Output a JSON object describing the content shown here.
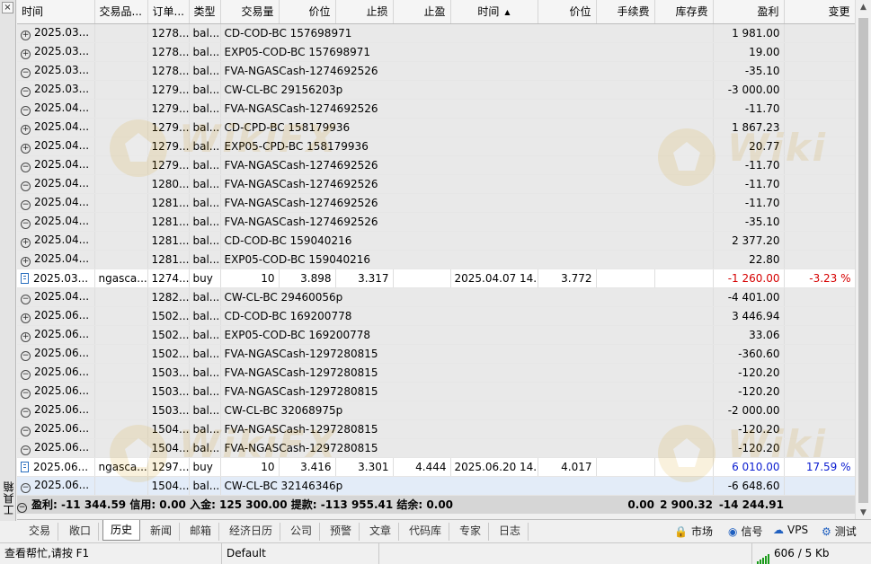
{
  "columns": [
    "时间",
    "交易品...",
    "订单...",
    "类型",
    "交易量",
    "价位",
    "止损",
    "止盈",
    "时间",
    "价位",
    "手续费",
    "库存费",
    "盈利",
    "变更"
  ],
  "rows": [
    {
      "kind": "bal",
      "icon": "plus",
      "time": "2025.03...",
      "order": "1278...",
      "type": "bal...",
      "comment": "CD-COD-BC 157698971",
      "profit": "1 981.00",
      "sign": "none"
    },
    {
      "kind": "bal",
      "icon": "plus",
      "time": "2025.03...",
      "order": "1278...",
      "type": "bal...",
      "comment": "EXP05-COD-BC 157698971",
      "profit": "19.00",
      "sign": "none"
    },
    {
      "kind": "bal",
      "icon": "minus",
      "time": "2025.03...",
      "order": "1278...",
      "type": "bal...",
      "comment": "FVA-NGASCash-1274692526",
      "profit": "-35.10",
      "sign": "none"
    },
    {
      "kind": "bal",
      "icon": "minus",
      "time": "2025.03...",
      "order": "1279...",
      "type": "bal...",
      "comment": "CW-CL-BC 29156203p",
      "profit": "-3 000.00",
      "sign": "none"
    },
    {
      "kind": "bal",
      "icon": "minus",
      "time": "2025.04...",
      "order": "1279...",
      "type": "bal...",
      "comment": "FVA-NGASCash-1274692526",
      "profit": "-11.70",
      "sign": "none"
    },
    {
      "kind": "bal",
      "icon": "plus",
      "time": "2025.04...",
      "order": "1279...",
      "type": "bal...",
      "comment": "CD-CPD-BC 158179936",
      "profit": "1 867.23",
      "sign": "none"
    },
    {
      "kind": "bal",
      "icon": "plus",
      "time": "2025.04...",
      "order": "1279...",
      "type": "bal...",
      "comment": "EXP05-CPD-BC 158179936",
      "profit": "20.77",
      "sign": "none"
    },
    {
      "kind": "bal",
      "icon": "minus",
      "time": "2025.04...",
      "order": "1279...",
      "type": "bal...",
      "comment": "FVA-NGASCash-1274692526",
      "profit": "-11.70",
      "sign": "none"
    },
    {
      "kind": "bal",
      "icon": "minus",
      "time": "2025.04...",
      "order": "1280...",
      "type": "bal...",
      "comment": "FVA-NGASCash-1274692526",
      "profit": "-11.70",
      "sign": "none"
    },
    {
      "kind": "bal",
      "icon": "minus",
      "time": "2025.04...",
      "order": "1281...",
      "type": "bal...",
      "comment": "FVA-NGASCash-1274692526",
      "profit": "-11.70",
      "sign": "none"
    },
    {
      "kind": "bal",
      "icon": "minus",
      "time": "2025.04...",
      "order": "1281...",
      "type": "bal...",
      "comment": "FVA-NGASCash-1274692526",
      "profit": "-35.10",
      "sign": "none"
    },
    {
      "kind": "bal",
      "icon": "plus",
      "time": "2025.04...",
      "order": "1281...",
      "type": "bal...",
      "comment": "CD-COD-BC 159040216",
      "profit": "2 377.20",
      "sign": "none"
    },
    {
      "kind": "bal",
      "icon": "plus",
      "time": "2025.04...",
      "order": "1281...",
      "type": "bal...",
      "comment": "EXP05-COD-BC 159040216",
      "profit": "22.80",
      "sign": "none"
    },
    {
      "kind": "trade",
      "icon": "trade",
      "time": "2025.03...",
      "symbol": "ngasca...",
      "order": "1274...",
      "type": "buy",
      "volume": "10",
      "price": "3.898",
      "sl": "3.317",
      "tp": "",
      "close_time": "2025.04.07 14...",
      "close_price": "3.772",
      "commission": "",
      "swap": "",
      "profit": "-1 260.00",
      "change": "-3.23 %",
      "sign": "neg"
    },
    {
      "kind": "bal",
      "icon": "minus",
      "time": "2025.04...",
      "order": "1282...",
      "type": "bal...",
      "comment": "CW-CL-BC 29460056p",
      "profit": "-4 401.00",
      "sign": "none"
    },
    {
      "kind": "bal",
      "icon": "plus",
      "time": "2025.06...",
      "order": "1502...",
      "type": "bal...",
      "comment": "CD-COD-BC 169200778",
      "profit": "3 446.94",
      "sign": "none"
    },
    {
      "kind": "bal",
      "icon": "plus",
      "time": "2025.06...",
      "order": "1502...",
      "type": "bal...",
      "comment": "EXP05-COD-BC 169200778",
      "profit": "33.06",
      "sign": "none"
    },
    {
      "kind": "bal",
      "icon": "minus",
      "time": "2025.06...",
      "order": "1502...",
      "type": "bal...",
      "comment": "FVA-NGASCash-1297280815",
      "profit": "-360.60",
      "sign": "none"
    },
    {
      "kind": "bal",
      "icon": "minus",
      "time": "2025.06...",
      "order": "1503...",
      "type": "bal...",
      "comment": "FVA-NGASCash-1297280815",
      "profit": "-120.20",
      "sign": "none"
    },
    {
      "kind": "bal",
      "icon": "minus",
      "time": "2025.06...",
      "order": "1503...",
      "type": "bal...",
      "comment": "FVA-NGASCash-1297280815",
      "profit": "-120.20",
      "sign": "none"
    },
    {
      "kind": "bal",
      "icon": "minus",
      "time": "2025.06...",
      "order": "1503...",
      "type": "bal...",
      "comment": "CW-CL-BC 32068975p",
      "profit": "-2 000.00",
      "sign": "none"
    },
    {
      "kind": "bal",
      "icon": "minus",
      "time": "2025.06...",
      "order": "1504...",
      "type": "bal...",
      "comment": "FVA-NGASCash-1297280815",
      "profit": "-120.20",
      "sign": "none"
    },
    {
      "kind": "bal",
      "icon": "minus",
      "time": "2025.06...",
      "order": "1504...",
      "type": "bal...",
      "comment": "FVA-NGASCash-1297280815",
      "profit": "-120.20",
      "sign": "none"
    },
    {
      "kind": "trade",
      "icon": "trade",
      "time": "2025.06...",
      "symbol": "ngasca...",
      "order": "1297...",
      "type": "buy",
      "volume": "10",
      "price": "3.416",
      "sl": "3.301",
      "tp": "4.444",
      "close_time": "2025.06.20 14...",
      "close_price": "4.017",
      "commission": "",
      "swap": "",
      "profit": "6 010.00",
      "change": "17.59 %",
      "sign": "pos"
    },
    {
      "kind": "bal",
      "icon": "minus",
      "time": "2025.06...",
      "order": "1504...",
      "type": "bal...",
      "comment": "CW-CL-BC 32146346p",
      "profit": "-6 648.60",
      "sign": "none",
      "selected": true
    }
  ],
  "summary": {
    "text": "盈利: -11 344.59  信用: 0.00  入金: 125 300.00  提款: -113 955.41  结余: 0.00",
    "commission": "0.00",
    "swap": "2 900.32",
    "profit": "-14 244.91"
  },
  "toolbox_label": "工具箱",
  "tabs": [
    "交易",
    "敞口",
    "历史",
    "新闻",
    "邮箱",
    "经济日历",
    "公司",
    "预警",
    "文章",
    "代码库",
    "专家",
    "日志"
  ],
  "active_tab": "历史",
  "right_tabs": [
    {
      "icon": "market-icon",
      "label": "市场"
    },
    {
      "icon": "signal-icon",
      "label": "信号"
    },
    {
      "icon": "vps-icon",
      "label": "VPS"
    },
    {
      "icon": "tester-icon",
      "label": "测试"
    }
  ],
  "status": {
    "help": "查看帮忙,请按 F1",
    "profile": "Default",
    "traffic": "606 / 5 Kb"
  },
  "colors": {
    "negative": "#d60000",
    "positive": "#0a1cd0",
    "balance_row": "#e9e9e9",
    "selected_row": "#e3ecf8",
    "summary_row": "#d6d6d6"
  }
}
